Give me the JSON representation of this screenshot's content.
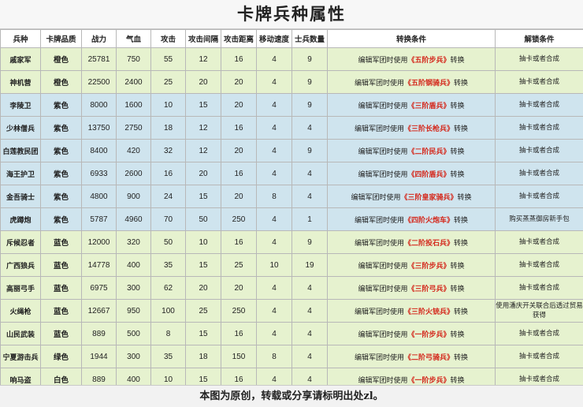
{
  "title": "卡牌兵种属性",
  "headers": [
    "兵种",
    "卡牌品质",
    "战力",
    "气血",
    "攻击",
    "攻击间隔",
    "攻击距离",
    "移动速度",
    "士兵数量",
    "转换条件",
    "解锁条件"
  ],
  "rows": [
    {
      "name": "戚家军",
      "quality": "橙色",
      "power": "25781",
      "hp": "750",
      "atk": "55",
      "interval": "12",
      "range": "16",
      "speed": "4",
      "count": "9",
      "cond_pre": "编辑军团时使用",
      "cond_unit": "《五阶步兵》",
      "cond_post": "转换",
      "unlock": "抽卡或者合成",
      "tier": "orange"
    },
    {
      "name": "神机营",
      "quality": "橙色",
      "power": "22500",
      "hp": "2400",
      "atk": "25",
      "interval": "20",
      "range": "20",
      "speed": "4",
      "count": "9",
      "cond_pre": "编辑军团时使用",
      "cond_unit": "《五阶钢骑兵》",
      "cond_post": "转换",
      "unlock": "抽卡或者合成",
      "tier": "orange"
    },
    {
      "name": "李陵卫",
      "quality": "紫色",
      "power": "8000",
      "hp": "1600",
      "atk": "10",
      "interval": "15",
      "range": "20",
      "speed": "4",
      "count": "9",
      "cond_pre": "编辑军团时使用",
      "cond_unit": "《三阶盾兵》",
      "cond_post": "转换",
      "unlock": "抽卡或者合成",
      "tier": "purple"
    },
    {
      "name": "少林僧兵",
      "quality": "紫色",
      "power": "13750",
      "hp": "2750",
      "atk": "18",
      "interval": "12",
      "range": "16",
      "speed": "4",
      "count": "4",
      "cond_pre": "编辑军团时使用",
      "cond_unit": "《三阶长枪兵》",
      "cond_post": "转换",
      "unlock": "抽卡或者合成",
      "tier": "purple"
    },
    {
      "name": "白莲教民团",
      "quality": "紫色",
      "power": "8400",
      "hp": "420",
      "atk": "32",
      "interval": "12",
      "range": "20",
      "speed": "4",
      "count": "9",
      "cond_pre": "编辑军团时使用",
      "cond_unit": "《二阶民兵》",
      "cond_post": "转换",
      "unlock": "抽卡或者合成",
      "tier": "purple"
    },
    {
      "name": "海王护卫",
      "quality": "紫色",
      "power": "6933",
      "hp": "2600",
      "atk": "16",
      "interval": "20",
      "range": "16",
      "speed": "4",
      "count": "4",
      "cond_pre": "编辑军团时使用",
      "cond_unit": "《四阶盾兵》",
      "cond_post": "转换",
      "unlock": "抽卡或者合成",
      "tier": "purple"
    },
    {
      "name": "金吾骑士",
      "quality": "紫色",
      "power": "4800",
      "hp": "900",
      "atk": "24",
      "interval": "15",
      "range": "20",
      "speed": "8",
      "count": "4",
      "cond_pre": "编辑军团时使用",
      "cond_unit": "《三阶皇家骑兵》",
      "cond_post": "转换",
      "unlock": "抽卡或者合成",
      "tier": "purple"
    },
    {
      "name": "虎蹲炮",
      "quality": "紫色",
      "power": "5787",
      "hp": "4960",
      "atk": "70",
      "interval": "50",
      "range": "250",
      "speed": "4",
      "count": "1",
      "cond_pre": "编辑军团时使用",
      "cond_unit": "《四阶火炮车》",
      "cond_post": "转换",
      "unlock": "购买蒸蒸御房新手包",
      "tier": "purple"
    },
    {
      "name": "斥候忍者",
      "quality": "蓝色",
      "power": "12000",
      "hp": "320",
      "atk": "50",
      "interval": "10",
      "range": "16",
      "speed": "4",
      "count": "9",
      "cond_pre": "编辑军团时使用",
      "cond_unit": "《二阶投石兵》",
      "cond_post": "转换",
      "unlock": "抽卡或者合成",
      "tier": "blue"
    },
    {
      "name": "广西狼兵",
      "quality": "蓝色",
      "power": "14778",
      "hp": "400",
      "atk": "35",
      "interval": "15",
      "range": "25",
      "speed": "10",
      "count": "19",
      "cond_pre": "编辑军团时使用",
      "cond_unit": "《三阶步兵》",
      "cond_post": "转换",
      "unlock": "抽卡或者合成",
      "tier": "blue"
    },
    {
      "name": "高丽弓手",
      "quality": "蓝色",
      "power": "6975",
      "hp": "300",
      "atk": "62",
      "interval": "20",
      "range": "20",
      "speed": "4",
      "count": "4",
      "cond_pre": "编辑军团时使用",
      "cond_unit": "《三阶弓兵》",
      "cond_post": "转换",
      "unlock": "抽卡或者合成",
      "tier": "blue"
    },
    {
      "name": "火绳枪",
      "quality": "蓝色",
      "power": "12667",
      "hp": "950",
      "atk": "100",
      "interval": "25",
      "range": "250",
      "speed": "4",
      "count": "4",
      "cond_pre": "编辑军团时使用",
      "cond_unit": "《三阶火铳兵》",
      "cond_post": "转换",
      "unlock": "使用潘庆开关联合后透过贸易获得",
      "tier": "blue"
    },
    {
      "name": "山民武装",
      "quality": "蓝色",
      "power": "889",
      "hp": "500",
      "atk": "8",
      "interval": "15",
      "range": "16",
      "speed": "4",
      "count": "4",
      "cond_pre": "编辑军团时使用",
      "cond_unit": "《一阶步兵》",
      "cond_post": "转换",
      "unlock": "抽卡或者合成",
      "tier": "blue"
    },
    {
      "name": "宁夏游击兵",
      "quality": "绿色",
      "power": "1944",
      "hp": "300",
      "atk": "35",
      "interval": "18",
      "range": "150",
      "speed": "8",
      "count": "4",
      "cond_pre": "编辑军团时使用",
      "cond_unit": "《二阶弓骑兵》",
      "cond_post": "转换",
      "unlock": "抽卡或者合成",
      "tier": "green"
    },
    {
      "name": "响马盗",
      "quality": "白色",
      "power": "889",
      "hp": "400",
      "atk": "10",
      "interval": "15",
      "range": "16",
      "speed": "4",
      "count": "4",
      "cond_pre": "编辑军团时使用",
      "cond_unit": "《一阶步兵》",
      "cond_post": "转换",
      "unlock": "抽卡或者合成",
      "tier": "white"
    }
  ],
  "footer": "本图为原创，转载或分享请标明出处zl。",
  "colors": {
    "row_green": "#e6f2cf",
    "row_blue": "#cfe4ee",
    "highlight_red": "#d42a1e"
  }
}
